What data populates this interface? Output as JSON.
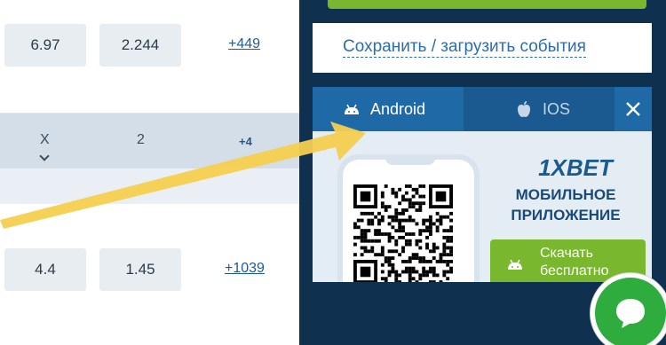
{
  "odds_top": [
    "6.97",
    "2.244"
  ],
  "more_top": "+449",
  "header": {
    "col_x": "X",
    "col_2": "2",
    "more": "+4"
  },
  "odds_bottom": [
    "4.4",
    "1.45"
  ],
  "more_bottom": "+1039",
  "save_events": "Сохранить / загрузить события",
  "app_promo": {
    "tabs": {
      "android": "Android",
      "ios": "IOS"
    },
    "brand": "1XBET",
    "subtitle_line1": "МОБИЛЬНОЕ",
    "subtitle_line2": "ПРИЛОЖЕНИЕ",
    "download_line1": "Скачать",
    "download_line2": "бесплатно"
  },
  "colors": {
    "accent_green": "#78b72e",
    "dark_panel": "#10304f",
    "tab_blue": "#1f6aa6",
    "arrow": "#f5cf4f"
  },
  "icons": [
    "android-icon",
    "apple-icon",
    "close-icon",
    "chevron-down-icon",
    "chat-icon",
    "qr-code"
  ]
}
